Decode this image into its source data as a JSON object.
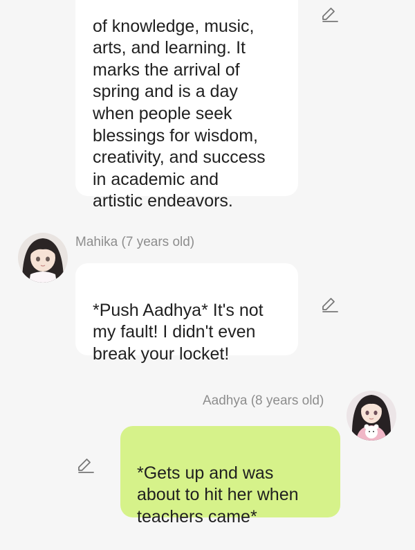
{
  "messages": [
    {
      "sender": "",
      "text": "of knowledge, music,\narts, and learning. It\nmarks the arrival of\nspring and is a day\nwhen people seek\nblessings for wisdom,\ncreativity, and success\nin academic and\nartistic endeavors."
    },
    {
      "sender": "Mahika (7 years old)",
      "text": "*Push Aadhya* It's not\nmy fault! I didn't even\nbreak your locket!"
    },
    {
      "sender": "Aadhya (8 years old)",
      "text": "*Gets up and was\nabout to hit her when\nteachers came*"
    }
  ],
  "icons": {
    "edit": "pencil-icon",
    "avatar": "avatar-image"
  },
  "colors": {
    "background": "#f6f6f6",
    "incoming_bubble": "#ffffff",
    "outgoing_bubble": "#d6f28a",
    "sender_name": "#8d8d8d",
    "icon": "#777777"
  }
}
